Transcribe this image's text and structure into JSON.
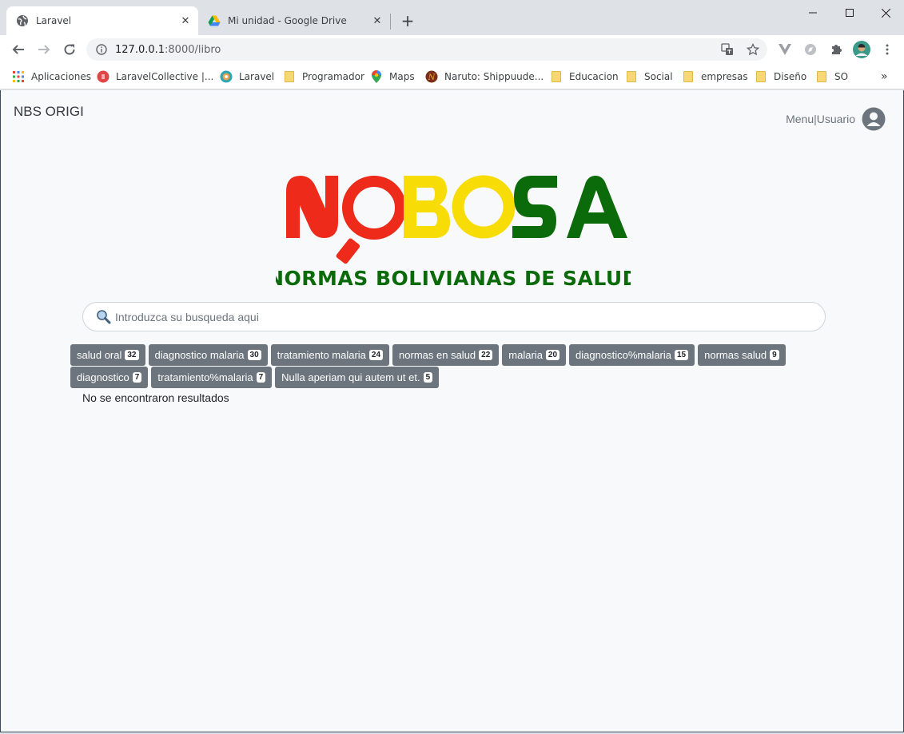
{
  "browser": {
    "tabs": [
      {
        "title": "Laravel",
        "icon": "globe-icon",
        "active": true
      },
      {
        "title": "Mi unidad - Google Drive",
        "icon": "google-drive-icon",
        "active": false
      }
    ],
    "address": {
      "host": "127.0.0.1",
      "path": ":8000/libro"
    },
    "bookmarks": [
      {
        "label": "Aplicaciones",
        "icon": "apps-grid-icon"
      },
      {
        "label": "LaravelCollective |...",
        "icon": "laravelcollective-icon"
      },
      {
        "label": "Laravel",
        "icon": "laravel-icon"
      },
      {
        "label": "Programador",
        "icon": "folder-icon"
      },
      {
        "label": "Maps",
        "icon": "maps-pin-icon"
      },
      {
        "label": "Naruto: Shippuude...",
        "icon": "naruto-icon"
      },
      {
        "label": "Educacion",
        "icon": "folder-icon"
      },
      {
        "label": "Social",
        "icon": "folder-icon"
      },
      {
        "label": "empresas",
        "icon": "folder-icon"
      },
      {
        "label": "Diseño",
        "icon": "folder-icon"
      },
      {
        "label": "SO",
        "icon": "folder-icon"
      }
    ],
    "overflow": "»"
  },
  "page": {
    "brand": "NBS ORIGI",
    "user_menu": "Menu|Usuario",
    "logo": {
      "parts": [
        "NO",
        "BO",
        "SA"
      ],
      "tagline": "NORMAS BOLIVIANAS DE SALUD",
      "colors": {
        "red": "#ee2a1b",
        "yellow": "#f7dc06",
        "green": "#0b6b0b"
      }
    },
    "search": {
      "placeholder": "Introduzca su busqueda aqui"
    },
    "tags": [
      {
        "label": "salud oral",
        "count": "32"
      },
      {
        "label": "diagnostico malaria",
        "count": "30"
      },
      {
        "label": "tratamiento malaria",
        "count": "24"
      },
      {
        "label": "normas en salud",
        "count": "22"
      },
      {
        "label": "malaria",
        "count": "20"
      },
      {
        "label": "diagnostico%malaria",
        "count": "15"
      },
      {
        "label": "normas salud",
        "count": "9"
      },
      {
        "label": "diagnostico",
        "count": "7"
      },
      {
        "label": "tratamiento%malaria",
        "count": "7"
      },
      {
        "label": "Nulla aperiam qui autem ut et.",
        "count": "5"
      }
    ],
    "no_results": "No se encontraron resultados"
  }
}
